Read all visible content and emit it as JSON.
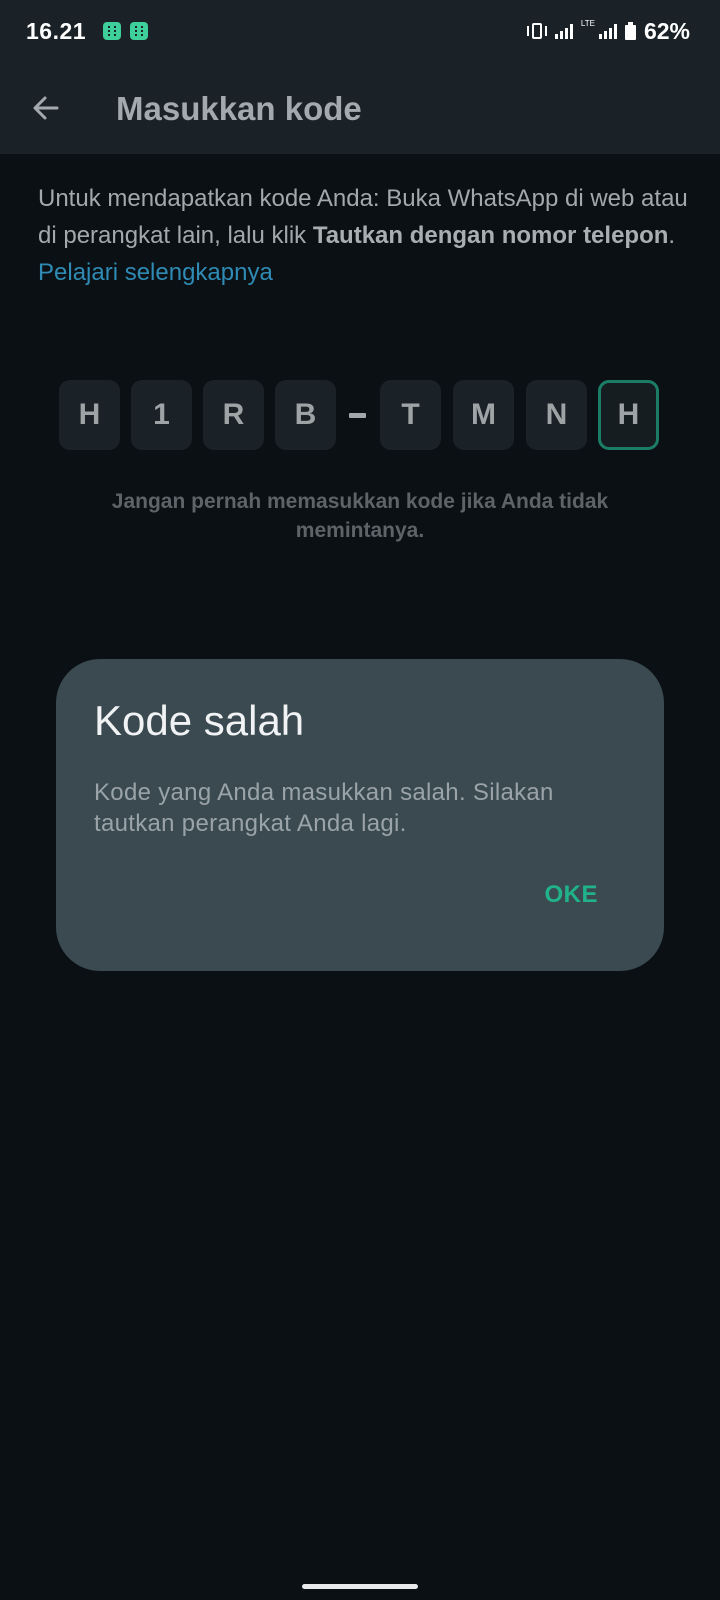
{
  "status_bar": {
    "time": "16.21",
    "network_label": "LTE",
    "battery_percent": "62%",
    "notification_icons": [
      "app-notification-icon",
      "app-notification-icon"
    ]
  },
  "app_bar": {
    "title": "Masukkan kode"
  },
  "instructions": {
    "text_part1": "Untuk mendapatkan kode Anda: Buka WhatsApp di web atau di perangkat lain, lalu klik ",
    "text_bold": "Tautkan dengan nomor telepon",
    "text_part2": ". ",
    "learn_more": "Pelajari selengkapnya"
  },
  "code": {
    "characters": [
      "H",
      "1",
      "R",
      "B",
      "T",
      "M",
      "N",
      "H"
    ],
    "separator_after_index": 3,
    "active_index": 7,
    "warning": "Jangan pernah memasukkan kode jika Anda tidak memintanya."
  },
  "dialog": {
    "title": "Kode salah",
    "message": "Kode yang Anda masukkan salah. Silakan tautkan perangkat Anda lagi.",
    "ok_label": "OKE"
  },
  "colors": {
    "background": "#0a1014",
    "bar": "#1b2227",
    "accent": "#20b38a",
    "link": "#2f8bb4",
    "dialog": "#3b4a51"
  }
}
